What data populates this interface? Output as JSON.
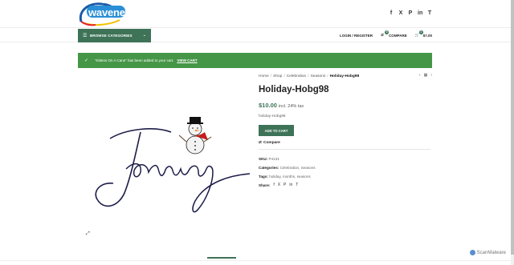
{
  "header": {
    "logo_text": "wavenet",
    "social": [
      "f",
      "X",
      "P",
      "in",
      "T"
    ]
  },
  "navbar": {
    "browse_label": "BROWSE CATEGORIES",
    "login_label": "LOGIN / REGISTER",
    "compare_label": "COMPARE",
    "compare_count": "0",
    "cart_count": "1",
    "cart_total": "$7.00"
  },
  "notice": {
    "message": "“Kittens On A Cane” has been added to your cart.",
    "link": "VIEW CART"
  },
  "breadcrumb": {
    "items": [
      "Home",
      "Shop",
      "Celebration",
      "Seasons"
    ],
    "current": "Holiday-Hobg98"
  },
  "product": {
    "title": "Holiday-Hobg98",
    "price": "$10.00",
    "price_suffix": "incl. 24% tax",
    "short_desc": "holiday-Hobg98",
    "add_to_cart": "ADD TO CART",
    "compare": "Compare",
    "sku_label": "SKU:",
    "sku": "P4131",
    "categories_label": "Categories:",
    "categories": "Celebration, Seasons",
    "tags_label": "Tags:",
    "tags": "holiday, months, seasons",
    "share_label": "Share:",
    "share_icons": [
      "f",
      "X",
      "P",
      "in",
      "T"
    ],
    "image_text": "January"
  },
  "watermark": "ScanMalware"
}
